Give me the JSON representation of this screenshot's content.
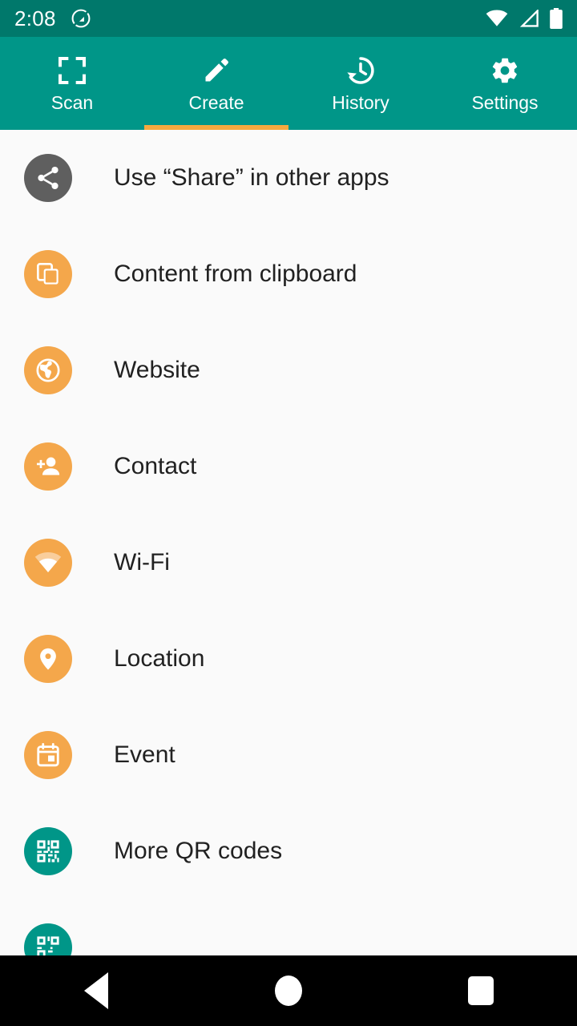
{
  "status_bar": {
    "time": "2:08",
    "left_icons": [
      "app-notification-icon"
    ],
    "right_icons": [
      "wifi-icon",
      "cell-signal-icon",
      "battery-icon"
    ],
    "background_color": "#00786B"
  },
  "tabs": {
    "active_index": 1,
    "indicator_color": "#F5A93F",
    "background_color": "#009688",
    "items": [
      {
        "label": "Scan",
        "icon": "scan-frame-icon"
      },
      {
        "label": "Create",
        "icon": "pencil-icon"
      },
      {
        "label": "History",
        "icon": "history-clock-icon"
      },
      {
        "label": "Settings",
        "icon": "gear-icon"
      }
    ]
  },
  "create_list": {
    "items": [
      {
        "label": "Use “Share” in other apps",
        "icon": "share-icon",
        "icon_color": "#5F5F5F"
      },
      {
        "label": "Content from clipboard",
        "icon": "clipboard-icon",
        "icon_color": "#F4A74B"
      },
      {
        "label": "Website",
        "icon": "globe-icon",
        "icon_color": "#F4A74B"
      },
      {
        "label": "Contact",
        "icon": "person-add-icon",
        "icon_color": "#F4A74B"
      },
      {
        "label": "Wi-Fi",
        "icon": "wifi-icon",
        "icon_color": "#F4A74B"
      },
      {
        "label": "Location",
        "icon": "map-pin-icon",
        "icon_color": "#F4A74B"
      },
      {
        "label": "Event",
        "icon": "calendar-icon",
        "icon_color": "#F4A74B"
      },
      {
        "label": "More QR codes",
        "icon": "qr-code-icon",
        "icon_color": "#009688"
      },
      {
        "label": "",
        "icon": "qr-code-icon",
        "icon_color": "#009688"
      }
    ]
  },
  "navigation_bar": {
    "buttons": [
      {
        "name": "back",
        "icon": "triangle-back-icon"
      },
      {
        "name": "home",
        "icon": "circle-home-icon"
      },
      {
        "name": "recent",
        "icon": "square-recents-icon"
      }
    ]
  }
}
